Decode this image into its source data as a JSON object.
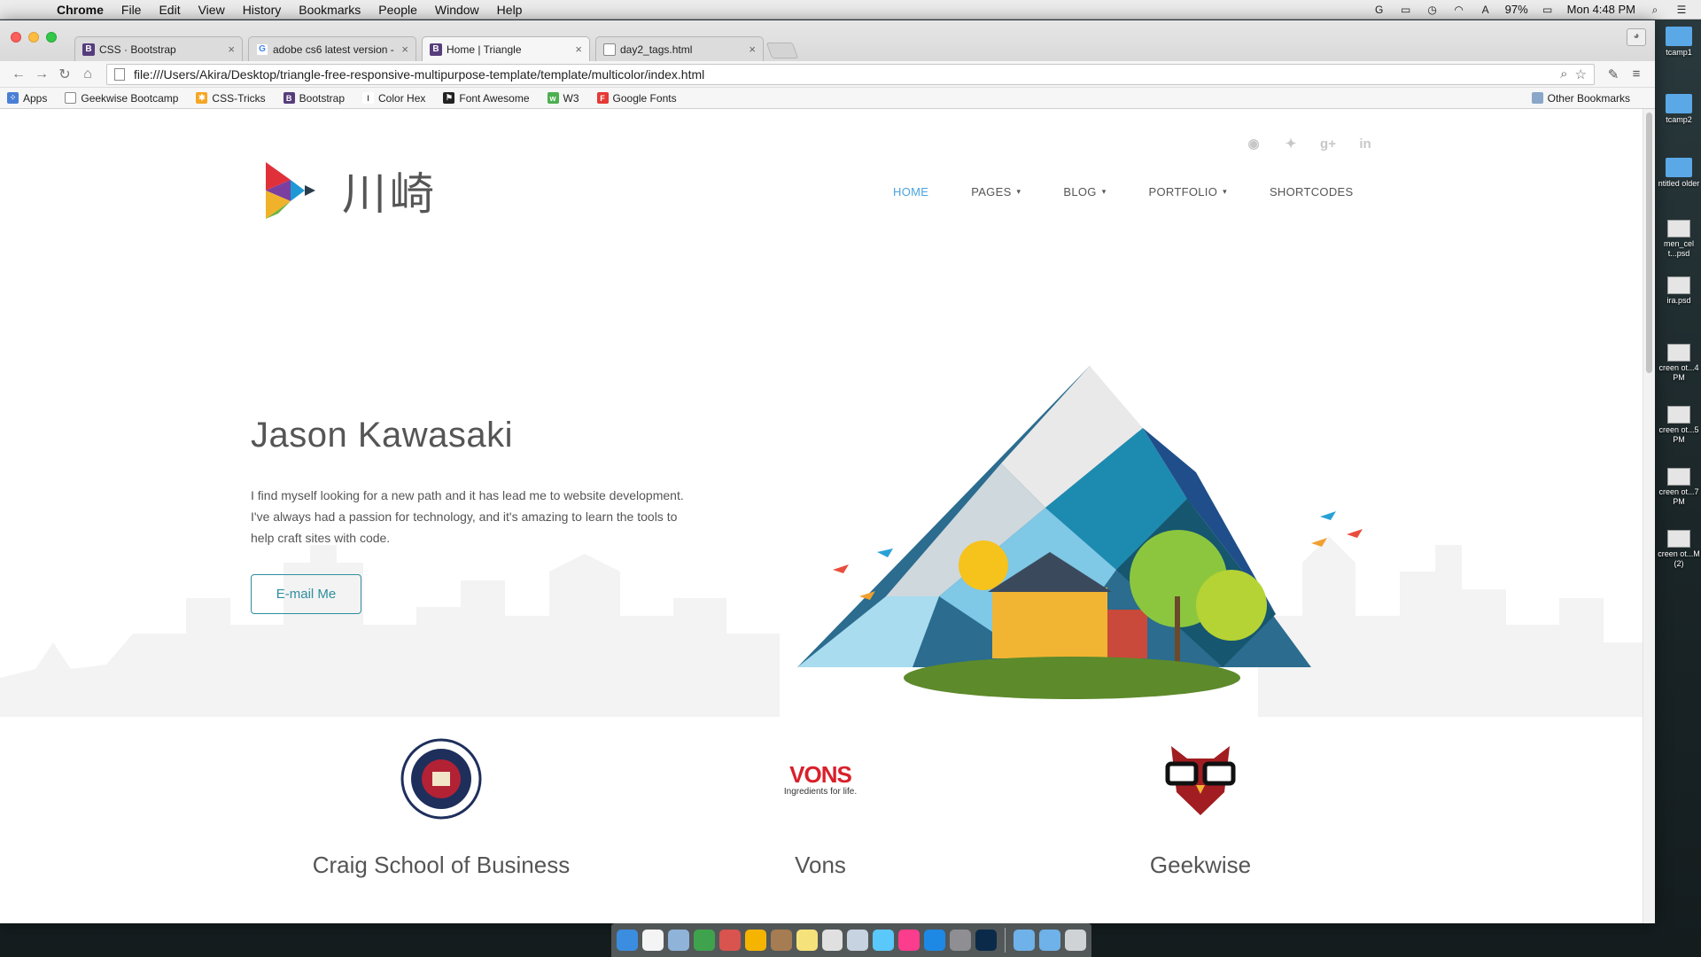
{
  "menubar": {
    "app": "Chrome",
    "items": [
      "File",
      "Edit",
      "View",
      "History",
      "Bookmarks",
      "People",
      "Window",
      "Help"
    ],
    "battery": "97%",
    "clock": "Mon 4:48 PM"
  },
  "tabs": [
    {
      "title": "CSS · Bootstrap",
      "favicon": "B"
    },
    {
      "title": "adobe cs6 latest version - ",
      "favicon": "G"
    },
    {
      "title": "Home | Triangle",
      "favicon": "B"
    },
    {
      "title": "day2_tags.html",
      "favicon": ""
    }
  ],
  "address_bar": {
    "url": "file:///Users/Akira/Desktop/triangle-free-responsive-multipurpose-template/template/multicolor/index.html"
  },
  "bookmarks": {
    "items": [
      "Apps",
      "Geekwise Bootcamp",
      "CSS-Tricks",
      "Bootstrap",
      "Color Hex",
      "Font Awesome",
      "W3",
      "Google Fonts"
    ],
    "other": "Other Bookmarks"
  },
  "site": {
    "logo_text": "川崎",
    "social_icons": [
      "github-icon",
      "twitter-icon",
      "google-plus-icon",
      "linkedin-icon"
    ],
    "nav": [
      {
        "label": "HOME",
        "active": true
      },
      {
        "label": "PAGES",
        "dropdown": true
      },
      {
        "label": "BLOG",
        "dropdown": true
      },
      {
        "label": "PORTFOLIO",
        "dropdown": true
      },
      {
        "label": "SHORTCODES"
      }
    ],
    "hero": {
      "name": "Jason Kawasaki",
      "description": "I find myself looking for a new path and it has lead me to website development. I've always had a passion for technology, and it's amazing to learn the tools to help craft sites with code.",
      "button": "E-mail Me"
    },
    "features": [
      {
        "title": "Craig School of Business"
      },
      {
        "title": "Vons",
        "logo_text": "VONS",
        "tagline": "Ingredients for life."
      },
      {
        "title": "Geekwise"
      }
    ],
    "accent_color": "#4aa3df",
    "button_color": "#2d8f9e"
  },
  "desktop_icons": [
    "tcamp1",
    "tcamp2",
    "ntitled older",
    "men_cel t...psd",
    "ira.psd",
    "creen ot...4 PM",
    "creen ot...5 PM",
    "creen ot...7 PM",
    "creen ot...M (2)"
  ]
}
